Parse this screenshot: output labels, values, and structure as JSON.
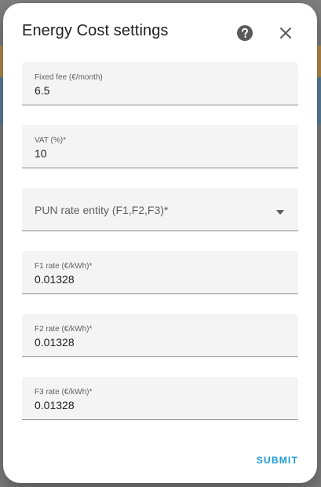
{
  "dialog": {
    "title": "Energy Cost settings",
    "help_icon": "help-circle-icon",
    "close_icon": "close-icon",
    "submit_label": "SUBMIT",
    "accent_color": "#1a9ad6"
  },
  "fields": {
    "fixed_fee": {
      "label": "Fixed fee (€/month)",
      "value": "6.5"
    },
    "vat": {
      "label": "VAT (%)*",
      "value": "10"
    },
    "pun_entity": {
      "label": "PUN rate entity (F1,F2,F3)*",
      "value": ""
    },
    "f1_rate": {
      "label": "F1 rate (€/kWh)*",
      "value": "0.01328"
    },
    "f2_rate": {
      "label": "F2 rate (€/kWh)*",
      "value": "0.01328"
    },
    "f3_rate": {
      "label": "F3 rate (€/kWh)*",
      "value": "0.01328"
    }
  }
}
